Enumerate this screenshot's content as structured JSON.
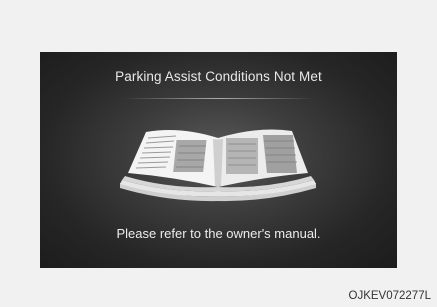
{
  "screen": {
    "title": "Parking Assist Conditions Not Met",
    "message": "Please refer to the owner's manual."
  },
  "figure_code": "OJKEV072277L",
  "icons": {
    "manual": "open-book-icon"
  }
}
